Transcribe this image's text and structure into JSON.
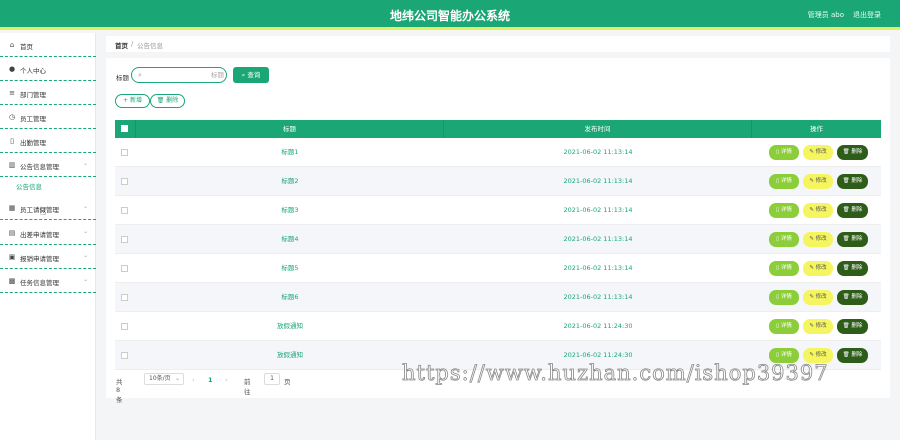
{
  "header": {
    "title": "地纬公司智能办公系统",
    "user": "管理员 abo",
    "logout": "退出登录"
  },
  "sidebar": {
    "items": [
      {
        "icon": "home-icon",
        "glyph": "⌂",
        "label": "首页"
      },
      {
        "icon": "user-icon",
        "glyph": "●",
        "label": "个人中心"
      },
      {
        "icon": "list-icon",
        "glyph": "≡",
        "label": "部门管理"
      },
      {
        "icon": "clock-icon",
        "glyph": "◷",
        "label": "员工管理"
      },
      {
        "icon": "bulb-icon",
        "glyph": "▯",
        "label": "出勤管理"
      },
      {
        "icon": "chart-icon",
        "glyph": "▥",
        "label": "公告信息管理"
      },
      {
        "icon": "grid-icon",
        "glyph": "▦",
        "label": "员工请假管理"
      },
      {
        "icon": "stack-icon",
        "glyph": "▤",
        "label": "出差申请管理"
      },
      {
        "icon": "doc-icon",
        "glyph": "▣",
        "label": "报销申请管理"
      },
      {
        "icon": "task-icon",
        "glyph": "▩",
        "label": "任务信息管理"
      }
    ],
    "sub_item": "公告信息"
  },
  "breadcrumb": {
    "home": "首页",
    "sep": "/",
    "current": "公告信息"
  },
  "search": {
    "label": "标题",
    "placeholder": "标题",
    "button": "查询"
  },
  "toolbar": {
    "add": "+ 新增",
    "delete": "删除"
  },
  "table": {
    "headers": [
      "标题",
      "发布时间",
      "操作"
    ],
    "actions": {
      "detail": "详情",
      "edit": "修改",
      "delete": "删除"
    },
    "rows": [
      {
        "title": "标题1",
        "time": "2021-06-02 11:13:14"
      },
      {
        "title": "标题2",
        "time": "2021-06-02 11:13:14"
      },
      {
        "title": "标题3",
        "time": "2021-06-02 11:13:14"
      },
      {
        "title": "标题4",
        "time": "2021-06-02 11:13:14"
      },
      {
        "title": "标题5",
        "time": "2021-06-02 11:13:14"
      },
      {
        "title": "标题6",
        "time": "2021-06-02 11:13:14"
      },
      {
        "title": "放假通知",
        "time": "2021-06-02 11:24:30"
      },
      {
        "title": "放假通知",
        "time": "2021-06-02 11:24:30"
      }
    ]
  },
  "pagination": {
    "total": "共 8 条",
    "page_size": "10条/页",
    "prev": "‹",
    "current": "1",
    "next": "›",
    "goto": "前往",
    "goto_page": "1",
    "page_unit": "页"
  },
  "watermark": "https://www.huzhan.com/ishop39397",
  "colors": {
    "primary": "#1aa675",
    "accent_bar": "#e3f25a",
    "detail": "#8ccd3a",
    "edit": "#f5f55f",
    "delete": "#2e5d1a"
  }
}
